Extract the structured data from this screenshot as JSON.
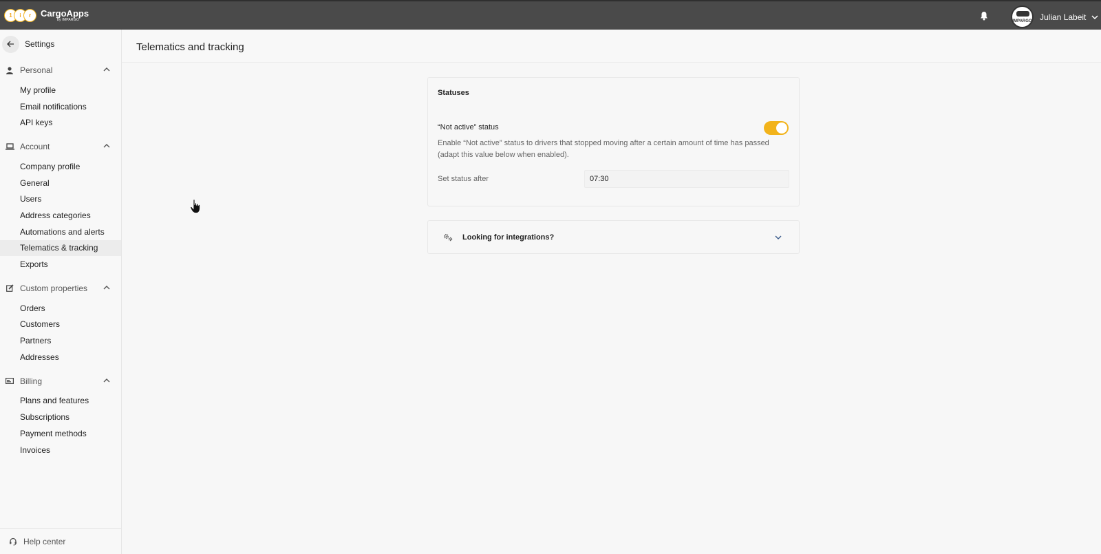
{
  "app": {
    "name": "CargoApps",
    "subtitle": "by IMPARGO"
  },
  "user": {
    "name": "Julian Labeit",
    "avatar_text": "IMPARGO"
  },
  "sidebar": {
    "back_title": "Settings",
    "sections": [
      {
        "label": "Personal",
        "icon": "person-icon",
        "items": [
          "My profile",
          "Email notifications",
          "API keys"
        ]
      },
      {
        "label": "Account",
        "icon": "laptop-icon",
        "items": [
          "Company profile",
          "General",
          "Users",
          "Address categories",
          "Automations and alerts",
          "Telematics & tracking",
          "Exports"
        ]
      },
      {
        "label": "Custom properties",
        "icon": "edit-icon",
        "items": [
          "Orders",
          "Customers",
          "Partners",
          "Addresses"
        ]
      },
      {
        "label": "Billing",
        "icon": "card-icon",
        "items": [
          "Plans and features",
          "Subscriptions",
          "Payment methods",
          "Invoices"
        ]
      }
    ],
    "active_item": "Telematics & tracking",
    "help_label": "Help center"
  },
  "page": {
    "title": "Telematics and tracking"
  },
  "statuses_card": {
    "title": "Statuses",
    "setting_label": "“Not active” status",
    "toggle_on": true,
    "description": "Enable “Not active” status to drivers that stopped moving after a certain amount of time has passed (adapt this value below when enabled).",
    "field_label": "Set status after",
    "field_value": "07:30"
  },
  "integrations": {
    "label": "Looking for integrations?"
  },
  "colors": {
    "accent": "#f2b31b",
    "topbar": "#4a4a4a"
  }
}
